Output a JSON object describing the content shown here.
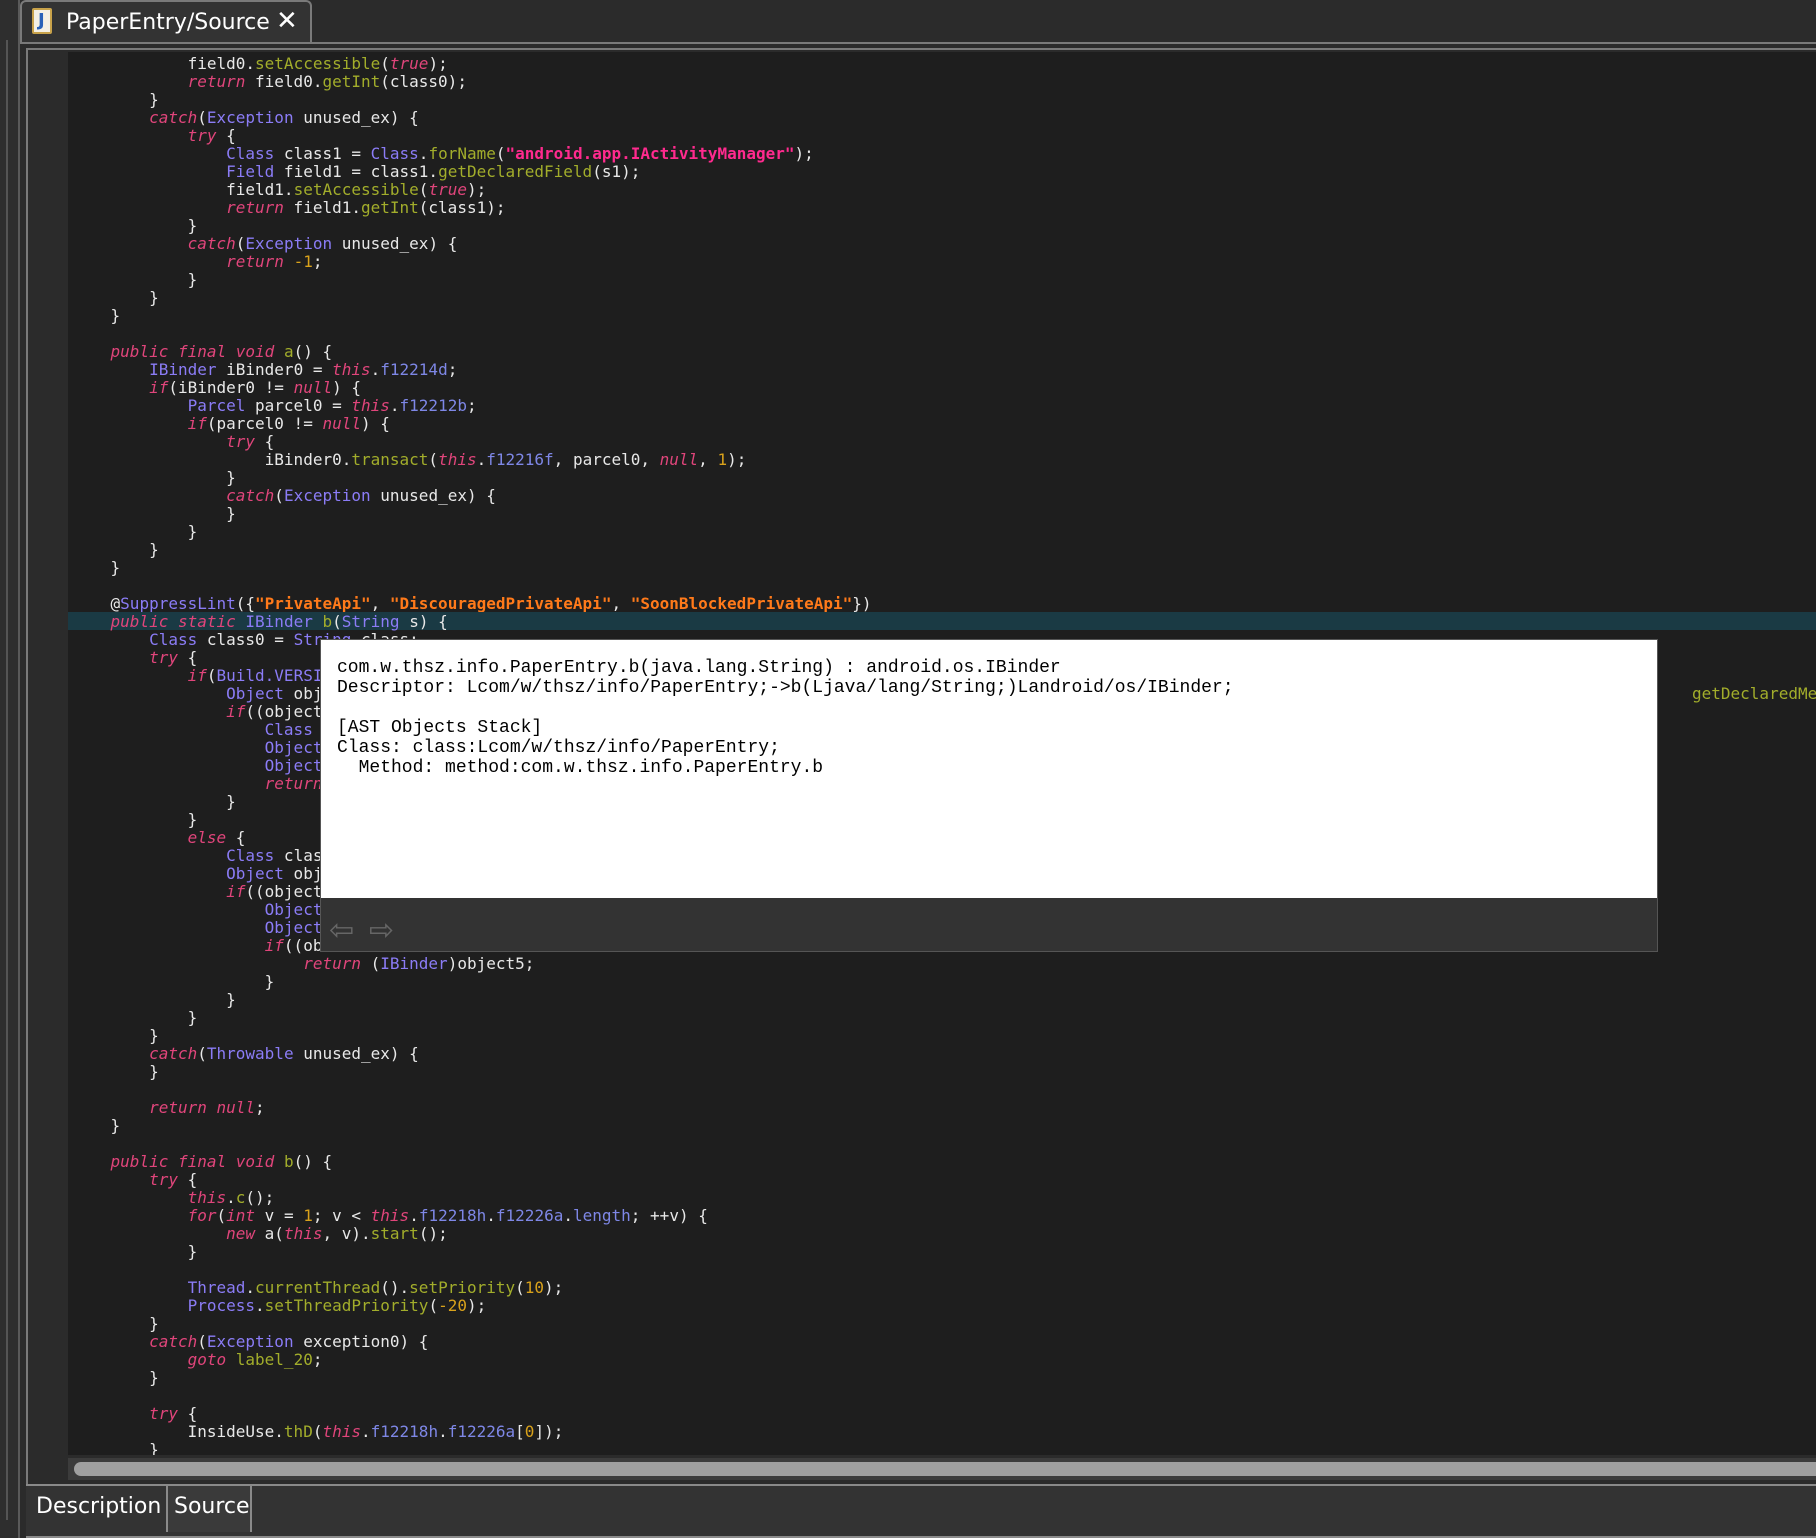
{
  "tab": {
    "title": "PaperEntry/Source",
    "icon": "java-file-icon",
    "close_icon": "close-icon"
  },
  "bottom_tabs": [
    "Description",
    "Source"
  ],
  "right_fragment": "getDeclaredMetho",
  "highlight_line": 32,
  "colors": {
    "background": "#1e1e1e",
    "keyword": "#e0457b",
    "type": "#8b7cf6",
    "method": "#a2ad2b",
    "field": "#7e87e6",
    "number": "#d9a21b",
    "string": "#ff2a8e",
    "annotation_string": "#ff7a1a",
    "highlight": "#1a3a44"
  },
  "tooltip": {
    "lines": [
      "com.w.thsz.info.PaperEntry.b(java.lang.String) : android.os.IBinder",
      "Descriptor: Lcom/w/thsz/info/PaperEntry;->b(Ljava/lang/String;)Landroid/os/IBinder;",
      "",
      "[AST Objects Stack]",
      "Class: class:Lcom/w/thsz/info/PaperEntry;",
      "  Method: method:com.w.thsz.info.PaperEntry.b"
    ],
    "back_icon": "arrow-left-icon",
    "forward_icon": "arrow-right-icon"
  },
  "code": [
    [
      [
        "p",
        "            field0."
      ],
      [
        "m",
        "setAccessible"
      ],
      [
        "p",
        "("
      ],
      [
        "k",
        "true"
      ],
      [
        "p",
        ");"
      ]
    ],
    [
      [
        "k",
        "            return"
      ],
      [
        "p",
        " field0."
      ],
      [
        "m",
        "getInt"
      ],
      [
        "p",
        "(class0);"
      ]
    ],
    [
      [
        "p",
        "        }"
      ]
    ],
    [
      [
        "k",
        "        catch"
      ],
      [
        "p",
        "("
      ],
      [
        "t",
        "Exception"
      ],
      [
        "p",
        " unused_ex) {"
      ]
    ],
    [
      [
        "k",
        "            try"
      ],
      [
        "p",
        " {"
      ]
    ],
    [
      [
        "t",
        "                Class"
      ],
      [
        "p",
        " class1 = "
      ],
      [
        "t",
        "Class"
      ],
      [
        "p",
        "."
      ],
      [
        "m",
        "forName"
      ],
      [
        "p",
        "("
      ],
      [
        "s",
        "\"android.app.IActivityManager\""
      ],
      [
        "p",
        ");"
      ]
    ],
    [
      [
        "t",
        "                Field"
      ],
      [
        "p",
        " field1 = class1."
      ],
      [
        "m",
        "getDeclaredField"
      ],
      [
        "p",
        "(s1);"
      ]
    ],
    [
      [
        "p",
        "                field1."
      ],
      [
        "m",
        "setAccessible"
      ],
      [
        "p",
        "("
      ],
      [
        "k",
        "true"
      ],
      [
        "p",
        ");"
      ]
    ],
    [
      [
        "k",
        "                return"
      ],
      [
        "p",
        " field1."
      ],
      [
        "m",
        "getInt"
      ],
      [
        "p",
        "(class1);"
      ]
    ],
    [
      [
        "p",
        "            }"
      ]
    ],
    [
      [
        "k",
        "            catch"
      ],
      [
        "p",
        "("
      ],
      [
        "t",
        "Exception"
      ],
      [
        "p",
        " unused_ex) {"
      ]
    ],
    [
      [
        "k",
        "                return"
      ],
      [
        "p",
        " "
      ],
      [
        "n",
        "-1"
      ],
      [
        "p",
        ";"
      ]
    ],
    [
      [
        "p",
        "            }"
      ]
    ],
    [
      [
        "p",
        "        }"
      ]
    ],
    [
      [
        "p",
        "    }"
      ]
    ],
    [],
    [
      [
        "k",
        "    public final void"
      ],
      [
        "p",
        " "
      ],
      [
        "m",
        "a"
      ],
      [
        "p",
        "() {"
      ]
    ],
    [
      [
        "t",
        "        IBinder"
      ],
      [
        "p",
        " iBinder0 = "
      ],
      [
        "k",
        "this"
      ],
      [
        "p",
        "."
      ],
      [
        "f",
        "f12214d"
      ],
      [
        "p",
        ";"
      ]
    ],
    [
      [
        "k",
        "        if"
      ],
      [
        "p",
        "(iBinder0 != "
      ],
      [
        "k",
        "null"
      ],
      [
        "p",
        ") {"
      ]
    ],
    [
      [
        "t",
        "            Parcel"
      ],
      [
        "p",
        " parcel0 = "
      ],
      [
        "k",
        "this"
      ],
      [
        "p",
        "."
      ],
      [
        "f",
        "f12212b"
      ],
      [
        "p",
        ";"
      ]
    ],
    [
      [
        "k",
        "            if"
      ],
      [
        "p",
        "(parcel0 != "
      ],
      [
        "k",
        "null"
      ],
      [
        "p",
        ") {"
      ]
    ],
    [
      [
        "k",
        "                try"
      ],
      [
        "p",
        " {"
      ]
    ],
    [
      [
        "p",
        "                    iBinder0."
      ],
      [
        "m",
        "transact"
      ],
      [
        "p",
        "("
      ],
      [
        "k",
        "this"
      ],
      [
        "p",
        "."
      ],
      [
        "f",
        "f12216f"
      ],
      [
        "p",
        ", parcel0, "
      ],
      [
        "k",
        "null"
      ],
      [
        "p",
        ", "
      ],
      [
        "n",
        "1"
      ],
      [
        "p",
        ");"
      ]
    ],
    [
      [
        "p",
        "                }"
      ]
    ],
    [
      [
        "k",
        "                catch"
      ],
      [
        "p",
        "("
      ],
      [
        "t",
        "Exception"
      ],
      [
        "p",
        " unused_ex) {"
      ]
    ],
    [
      [
        "p",
        "                }"
      ]
    ],
    [
      [
        "p",
        "            }"
      ]
    ],
    [
      [
        "p",
        "        }"
      ]
    ],
    [
      [
        "p",
        "    }"
      ]
    ],
    [],
    [
      [
        "p",
        "    @"
      ],
      [
        "t",
        "SuppressLint"
      ],
      [
        "p",
        "({"
      ],
      [
        "a",
        "\"PrivateApi\""
      ],
      [
        "p",
        ", "
      ],
      [
        "a",
        "\"DiscouragedPrivateApi\""
      ],
      [
        "p",
        ", "
      ],
      [
        "a",
        "\"SoonBlockedPrivateApi\""
      ],
      [
        "p",
        "})"
      ]
    ],
    [
      [
        "k",
        "    public static"
      ],
      [
        "p",
        " "
      ],
      [
        "t",
        "IBinder"
      ],
      [
        "p",
        " "
      ],
      [
        "m",
        "b"
      ],
      [
        "p",
        "("
      ],
      [
        "t",
        "String"
      ],
      [
        "p",
        " s) {"
      ]
    ],
    [
      [
        "t",
        "        Class"
      ],
      [
        "p",
        " class0 = "
      ],
      [
        "t",
        "String"
      ],
      [
        "p",
        ".class;"
      ]
    ],
    [
      [
        "k",
        "        try"
      ],
      [
        "p",
        " {"
      ]
    ],
    [
      [
        "k",
        "            if"
      ],
      [
        "p",
        "("
      ],
      [
        "t",
        "Build.VERSI"
      ]
    ],
    [
      [
        "t",
        "                Object"
      ],
      [
        "p",
        " obj"
      ]
    ],
    [
      [
        "k",
        "                if"
      ],
      [
        "p",
        "((object"
      ]
    ],
    [
      [
        "t",
        "                    Class"
      ]
    ],
    [
      [
        "t",
        "                    Object"
      ]
    ],
    [
      [
        "t",
        "                    Object"
      ]
    ],
    [
      [
        "k",
        "                    return"
      ]
    ],
    [
      [
        "p",
        "                }"
      ]
    ],
    [
      [
        "p",
        "            }"
      ]
    ],
    [
      [
        "k",
        "            else"
      ],
      [
        "p",
        " {"
      ]
    ],
    [
      [
        "t",
        "                Class"
      ],
      [
        "p",
        " clas"
      ]
    ],
    [
      [
        "t",
        "                Object"
      ],
      [
        "p",
        " obj"
      ]
    ],
    [
      [
        "k",
        "                if"
      ],
      [
        "p",
        "((object"
      ]
    ],
    [
      [
        "t",
        "                    Object"
      ]
    ],
    [
      [
        "t",
        "                    Object"
      ]
    ],
    [
      [
        "k",
        "                    if"
      ],
      [
        "p",
        "((ob"
      ]
    ],
    [
      [
        "k",
        "                        return"
      ],
      [
        "p",
        " ("
      ],
      [
        "t",
        "IBinder"
      ],
      [
        "p",
        ")object5;"
      ]
    ],
    [
      [
        "p",
        "                    }"
      ]
    ],
    [
      [
        "p",
        "                }"
      ]
    ],
    [
      [
        "p",
        "            }"
      ]
    ],
    [
      [
        "p",
        "        }"
      ]
    ],
    [
      [
        "k",
        "        catch"
      ],
      [
        "p",
        "("
      ],
      [
        "t",
        "Throwable"
      ],
      [
        "p",
        " unused_ex) {"
      ]
    ],
    [
      [
        "p",
        "        }"
      ]
    ],
    [],
    [
      [
        "k",
        "        return null"
      ],
      [
        "p",
        ";"
      ]
    ],
    [
      [
        "p",
        "    }"
      ]
    ],
    [],
    [
      [
        "k",
        "    public final void"
      ],
      [
        "p",
        " "
      ],
      [
        "m",
        "b"
      ],
      [
        "p",
        "() {"
      ]
    ],
    [
      [
        "k",
        "        try"
      ],
      [
        "p",
        " {"
      ]
    ],
    [
      [
        "k",
        "            this"
      ],
      [
        "p",
        "."
      ],
      [
        "m",
        "c"
      ],
      [
        "p",
        "();"
      ]
    ],
    [
      [
        "k",
        "            for"
      ],
      [
        "p",
        "("
      ],
      [
        "k",
        "int"
      ],
      [
        "p",
        " v = "
      ],
      [
        "n",
        "1"
      ],
      [
        "p",
        "; v < "
      ],
      [
        "k",
        "this"
      ],
      [
        "p",
        "."
      ],
      [
        "f",
        "f12218h"
      ],
      [
        "p",
        "."
      ],
      [
        "f",
        "f12226a"
      ],
      [
        "p",
        "."
      ],
      [
        "f",
        "length"
      ],
      [
        "p",
        "; ++v) {"
      ]
    ],
    [
      [
        "k",
        "                new"
      ],
      [
        "p",
        " a("
      ],
      [
        "k",
        "this"
      ],
      [
        "p",
        ", v)."
      ],
      [
        "m",
        "start"
      ],
      [
        "p",
        "();"
      ]
    ],
    [
      [
        "p",
        "            }"
      ]
    ],
    [],
    [
      [
        "t",
        "            Thread"
      ],
      [
        "p",
        "."
      ],
      [
        "m",
        "currentThread"
      ],
      [
        "p",
        "()."
      ],
      [
        "m",
        "setPriority"
      ],
      [
        "p",
        "("
      ],
      [
        "n",
        "10"
      ],
      [
        "p",
        ");"
      ]
    ],
    [
      [
        "t",
        "            Process"
      ],
      [
        "p",
        "."
      ],
      [
        "m",
        "setThreadPriority"
      ],
      [
        "p",
        "("
      ],
      [
        "n",
        "-20"
      ],
      [
        "p",
        ");"
      ]
    ],
    [
      [
        "p",
        "        }"
      ]
    ],
    [
      [
        "k",
        "        catch"
      ],
      [
        "p",
        "("
      ],
      [
        "t",
        "Exception"
      ],
      [
        "p",
        " exception0) {"
      ]
    ],
    [
      [
        "k",
        "            goto"
      ],
      [
        "p",
        " "
      ],
      [
        "m",
        "label_20"
      ],
      [
        "p",
        ";"
      ]
    ],
    [
      [
        "p",
        "        }"
      ]
    ],
    [],
    [
      [
        "k",
        "        try"
      ],
      [
        "p",
        " {"
      ]
    ],
    [
      [
        "p",
        "            InsideUse."
      ],
      [
        "m",
        "thD"
      ],
      [
        "p",
        "("
      ],
      [
        "k",
        "this"
      ],
      [
        "p",
        "."
      ],
      [
        "f",
        "f12218h"
      ],
      [
        "p",
        "."
      ],
      [
        "f",
        "f12226a"
      ],
      [
        "p",
        "["
      ],
      [
        "n",
        "0"
      ],
      [
        "p",
        "]);"
      ]
    ],
    [
      [
        "p",
        "        }"
      ]
    ]
  ]
}
